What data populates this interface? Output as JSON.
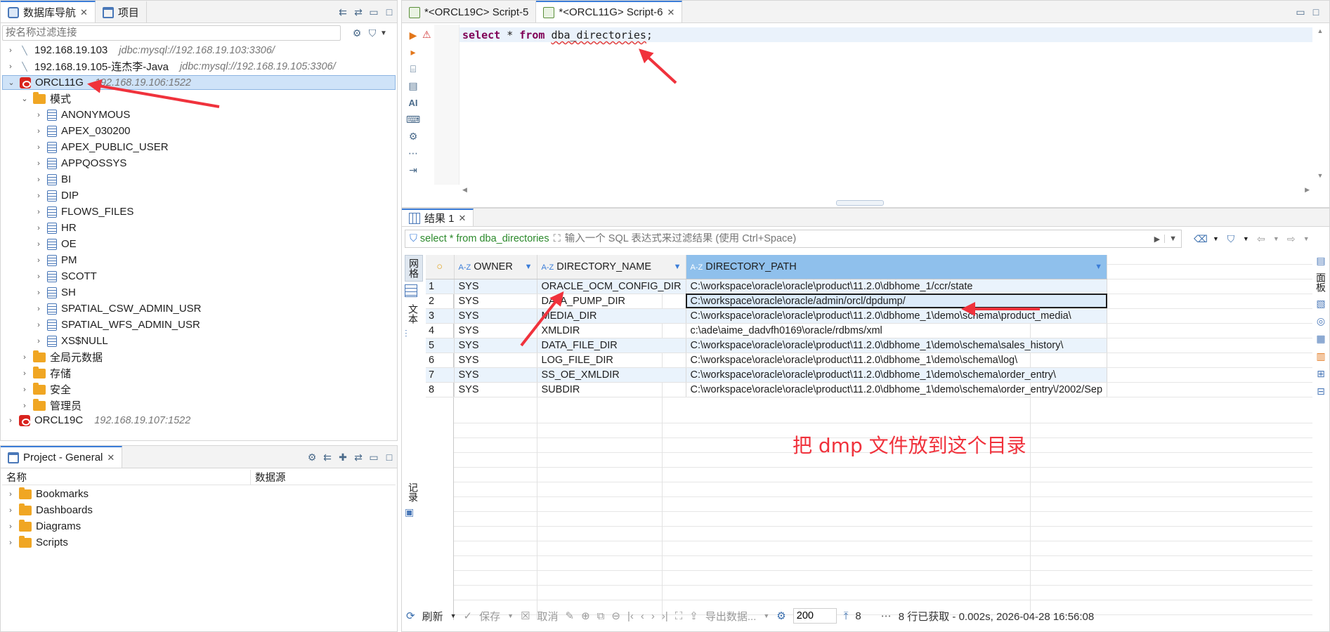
{
  "navigator": {
    "tab_db": "数据库导航",
    "tab_project": "项目",
    "filter_placeholder": "按名称过滤连接",
    "connections": [
      {
        "name": "192.168.19.103",
        "url": "jdbc:mysql://192.168.19.103:3306/"
      },
      {
        "name": "192.168.19.105-连杰李-Java",
        "url": "jdbc:mysql://192.168.19.105:3306/"
      },
      {
        "name": "ORCL11G",
        "url": "192.168.19.106:1522"
      },
      {
        "name": "ORCL19C",
        "url": "192.168.19.107:1522"
      }
    ],
    "schemas_folder": "模式",
    "schemas": [
      "ANONYMOUS",
      "APEX_030200",
      "APEX_PUBLIC_USER",
      "APPQOSSYS",
      "BI",
      "DIP",
      "FLOWS_FILES",
      "HR",
      "OE",
      "PM",
      "SCOTT",
      "SH",
      "SPATIAL_CSW_ADMIN_USR",
      "SPATIAL_WFS_ADMIN_USR",
      "XS$NULL"
    ],
    "other_folders": [
      "全局元数据",
      "存储",
      "安全",
      "管理员"
    ]
  },
  "project": {
    "title": "Project - General",
    "col_name": "名称",
    "col_source": "数据源",
    "items": [
      "Bookmarks",
      "Dashboards",
      "Diagrams",
      "Scripts"
    ]
  },
  "editor": {
    "tabs": [
      "*<ORCL19C> Script-5",
      "*<ORCL11G> Script-6"
    ],
    "sql_kw1": "select",
    "sql_star": " * ",
    "sql_kw2": "from",
    "sql_table": "dba_directories",
    "sql_end": ";"
  },
  "results": {
    "tab": "结果 1",
    "query_label": "select * from dba_directories",
    "filter_placeholder": "输入一个 SQL 表达式来过滤结果 (使用 Ctrl+Space)",
    "side_grid": "网格",
    "side_text": "文本",
    "side_log": "记录",
    "right_panel": "面板",
    "columns": [
      "OWNER",
      "DIRECTORY_NAME",
      "DIRECTORY_PATH"
    ],
    "rows": [
      [
        "1",
        "SYS",
        "ORACLE_OCM_CONFIG_DIR",
        "C:\\workspace\\oracle\\oracle\\product\\11.2.0\\dbhome_1/ccr/state"
      ],
      [
        "2",
        "SYS",
        "DATA_PUMP_DIR",
        "C:\\workspace\\oracle\\oracle/admin/orcl/dpdump/"
      ],
      [
        "3",
        "SYS",
        "MEDIA_DIR",
        "C:\\workspace\\oracle\\oracle\\product\\11.2.0\\dbhome_1\\demo\\schema\\product_media\\"
      ],
      [
        "4",
        "SYS",
        "XMLDIR",
        "c:\\ade\\aime_dadvfh0169\\oracle/rdbms/xml"
      ],
      [
        "5",
        "SYS",
        "DATA_FILE_DIR",
        "C:\\workspace\\oracle\\oracle\\product\\11.2.0\\dbhome_1\\demo\\schema\\sales_history\\"
      ],
      [
        "6",
        "SYS",
        "LOG_FILE_DIR",
        "C:\\workspace\\oracle\\oracle\\product\\11.2.0\\dbhome_1\\demo\\schema\\log\\"
      ],
      [
        "7",
        "SYS",
        "SS_OE_XMLDIR",
        "C:\\workspace\\oracle\\oracle\\product\\11.2.0\\dbhome_1\\demo\\schema\\order_entry\\"
      ],
      [
        "8",
        "SYS",
        "SUBDIR",
        "C:\\workspace\\oracle\\oracle\\product\\11.2.0\\dbhome_1\\demo\\schema\\order_entry\\/2002/Sep"
      ]
    ],
    "annotation": "把 dmp 文件放到这个目录"
  },
  "statusbar": {
    "refresh": "刷新",
    "save": "保存",
    "cancel": "取消",
    "export": "导出数据...",
    "fetch_size": "200",
    "row_count": "8",
    "status_text": "8 行已获取 - 0.002s, 2026-04-28 16:56:08"
  },
  "colors": {
    "accent": "#3b7dd8",
    "annotation": "#f0323c",
    "selection": "#cfe3f8"
  }
}
